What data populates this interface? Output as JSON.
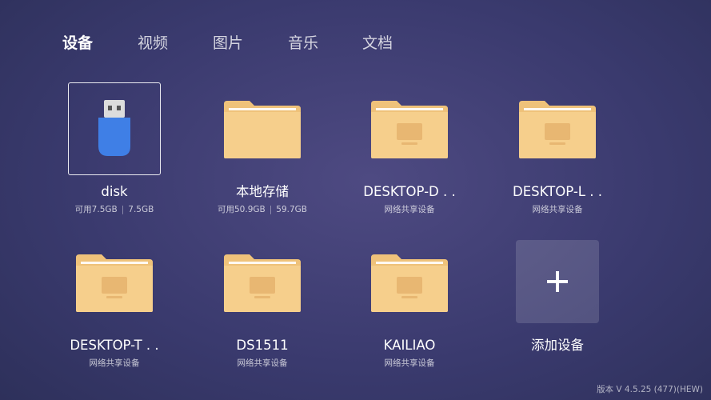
{
  "tabs": [
    {
      "label": "设备",
      "active": true
    },
    {
      "label": "视频",
      "active": false
    },
    {
      "label": "图片",
      "active": false
    },
    {
      "label": "音乐",
      "active": false
    },
    {
      "label": "文档",
      "active": false
    }
  ],
  "devices": [
    {
      "name": "disk",
      "sub_available": "可用7.5GB",
      "sub_total": "7.5GB",
      "icon": "usb-drive-icon"
    },
    {
      "name": "本地存储",
      "sub_available": "可用50.9GB",
      "sub_total": "59.7GB",
      "icon": "folder-icon"
    },
    {
      "name": "DESKTOP-D . .",
      "sub": "网络共享设备",
      "icon": "network-folder-icon"
    },
    {
      "name": "DESKTOP-L . .",
      "sub": "网络共享设备",
      "icon": "network-folder-icon"
    },
    {
      "name": "DESKTOP-T . .",
      "sub": "网络共享设备",
      "icon": "network-folder-icon"
    },
    {
      "name": "DS1511",
      "sub": "网络共享设备",
      "icon": "network-folder-icon"
    },
    {
      "name": "KAILIAO",
      "sub": "网络共享设备",
      "icon": "network-folder-icon"
    }
  ],
  "add_device": {
    "label": "添加设备",
    "icon": "plus-icon"
  },
  "version": "版本 V 4.5.25 (477)(HEW)",
  "colors": {
    "folder": "#f6cf8c",
    "folder_tab": "#efc27a",
    "usb_body": "#3f7fe6",
    "usb_cap": "#dcdcdc"
  }
}
